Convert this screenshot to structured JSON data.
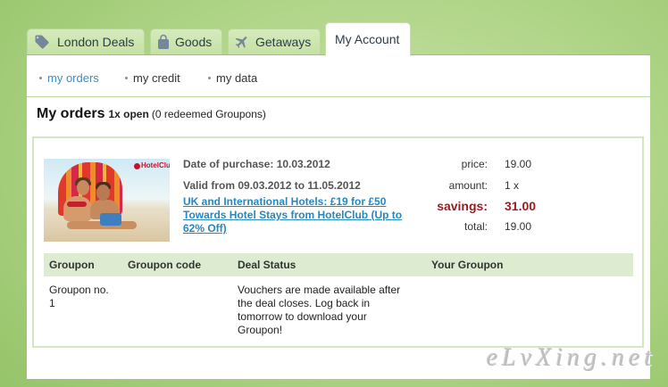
{
  "tabs": [
    {
      "label": "London Deals",
      "icon": "tag-icon",
      "active": false
    },
    {
      "label": "Goods",
      "icon": "shopping-bag-icon",
      "active": false
    },
    {
      "label": "Getaways",
      "icon": "airplane-icon",
      "active": false
    },
    {
      "label": "My Account",
      "active": true
    }
  ],
  "subnav": [
    {
      "label": "my orders",
      "active": true
    },
    {
      "label": "my credit",
      "active": false
    },
    {
      "label": "my data",
      "active": false
    }
  ],
  "orders_header": {
    "title": "My orders",
    "open_count": "1x open",
    "redeemed_note": "(0 redeemed Groupons)"
  },
  "order": {
    "image_logo": "HotelClub",
    "purchase_date": "Date of purchase: 10.03.2012",
    "validity": "Valid from 09.03.2012 to 11.05.2012",
    "deal_title": "UK and International Hotels: £19 for £50 Towards Hotel Stays from HotelClub (Up to 62% Off)",
    "summary": [
      {
        "label": "price:",
        "value": "19.00"
      },
      {
        "label": "amount:",
        "value": "1 x"
      },
      {
        "label": "savings:",
        "value": "31.00",
        "highlight": true
      },
      {
        "label": "total:",
        "value": "19.00"
      }
    ],
    "table": {
      "headers": [
        "Groupon",
        "Groupon code",
        "Deal Status",
        "Your Groupon"
      ],
      "rows": [
        {
          "groupon": "Groupon no. 1",
          "status": "Vouchers are made available after the deal closes. Log back in tomorrow to download your Groupon!"
        }
      ]
    }
  },
  "watermark": "eLvXing.net",
  "colors": {
    "link": "#2688c1",
    "active_subnav": "#3a8fca",
    "savings": "#9e1a20",
    "tab_background": "#c5e1a4",
    "table_header": "#ddecd0",
    "page_background": "#afd487"
  }
}
